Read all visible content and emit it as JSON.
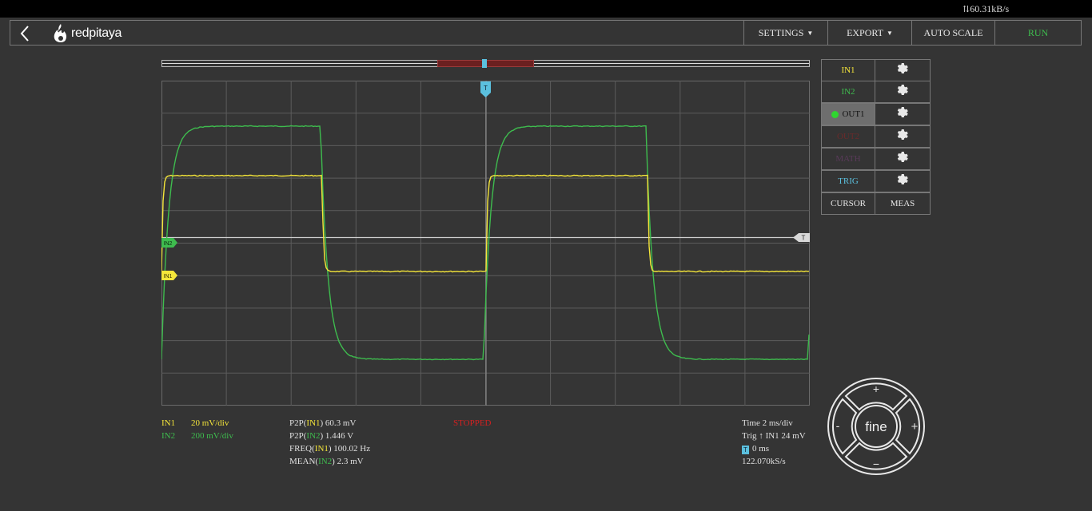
{
  "status_bar": {
    "net_rate": "60.31kB/s"
  },
  "header": {
    "logo_text": "redpitaya",
    "settings_label": "SETTINGS",
    "export_label": "EXPORT",
    "autoscale_label": "AUTO SCALE",
    "run_label": "RUN"
  },
  "channels": [
    {
      "label": "IN1",
      "color": "#f5e63a"
    },
    {
      "label": "IN2",
      "color": "#3ebc4e"
    },
    {
      "label": "OUT1",
      "color": "#111111"
    },
    {
      "label": "OUT2",
      "color": "#6b2a2a"
    },
    {
      "label": "MATH",
      "color": "#5a3a5a"
    },
    {
      "label": "TRIG",
      "color": "#5bc0de"
    }
  ],
  "cursor_label": "CURSOR",
  "meas_label": "MEAS",
  "plot": {
    "in1_marker": "IN1",
    "in2_marker": "IN2",
    "trig_marker": "T",
    "trig_level_marker": "T"
  },
  "scale_info": {
    "in1_label": "IN1",
    "in1_scale": "20 mV/div",
    "in2_label": "IN2",
    "in2_scale": "200 mV/div"
  },
  "measurements": {
    "p2p_in1_prefix": "P2P(",
    "p2p_in1_ch": "IN1",
    "p2p_in1_value": ") 60.3  mV",
    "p2p_in2_prefix": "P2P(",
    "p2p_in2_ch": "IN2",
    "p2p_in2_value": ") 1.446  V",
    "freq_prefix": "FREQ(",
    "freq_ch": "IN1",
    "freq_value": ") 100.02  Hz",
    "mean_prefix": "MEAN(",
    "mean_ch": "IN2",
    "mean_value": ") 2.3  mV"
  },
  "acq_status": "STOPPED",
  "timebase": {
    "time": "Time  2 ms/div",
    "trig_prefix": "Trig",
    "trig_value": "IN1  24  mV",
    "trig_delay": "0  ms",
    "sample_rate": "122.070kS/s"
  },
  "dpad": {
    "center_label": "fine",
    "up": "+",
    "down": "−",
    "left": "-",
    "right": "+"
  }
}
